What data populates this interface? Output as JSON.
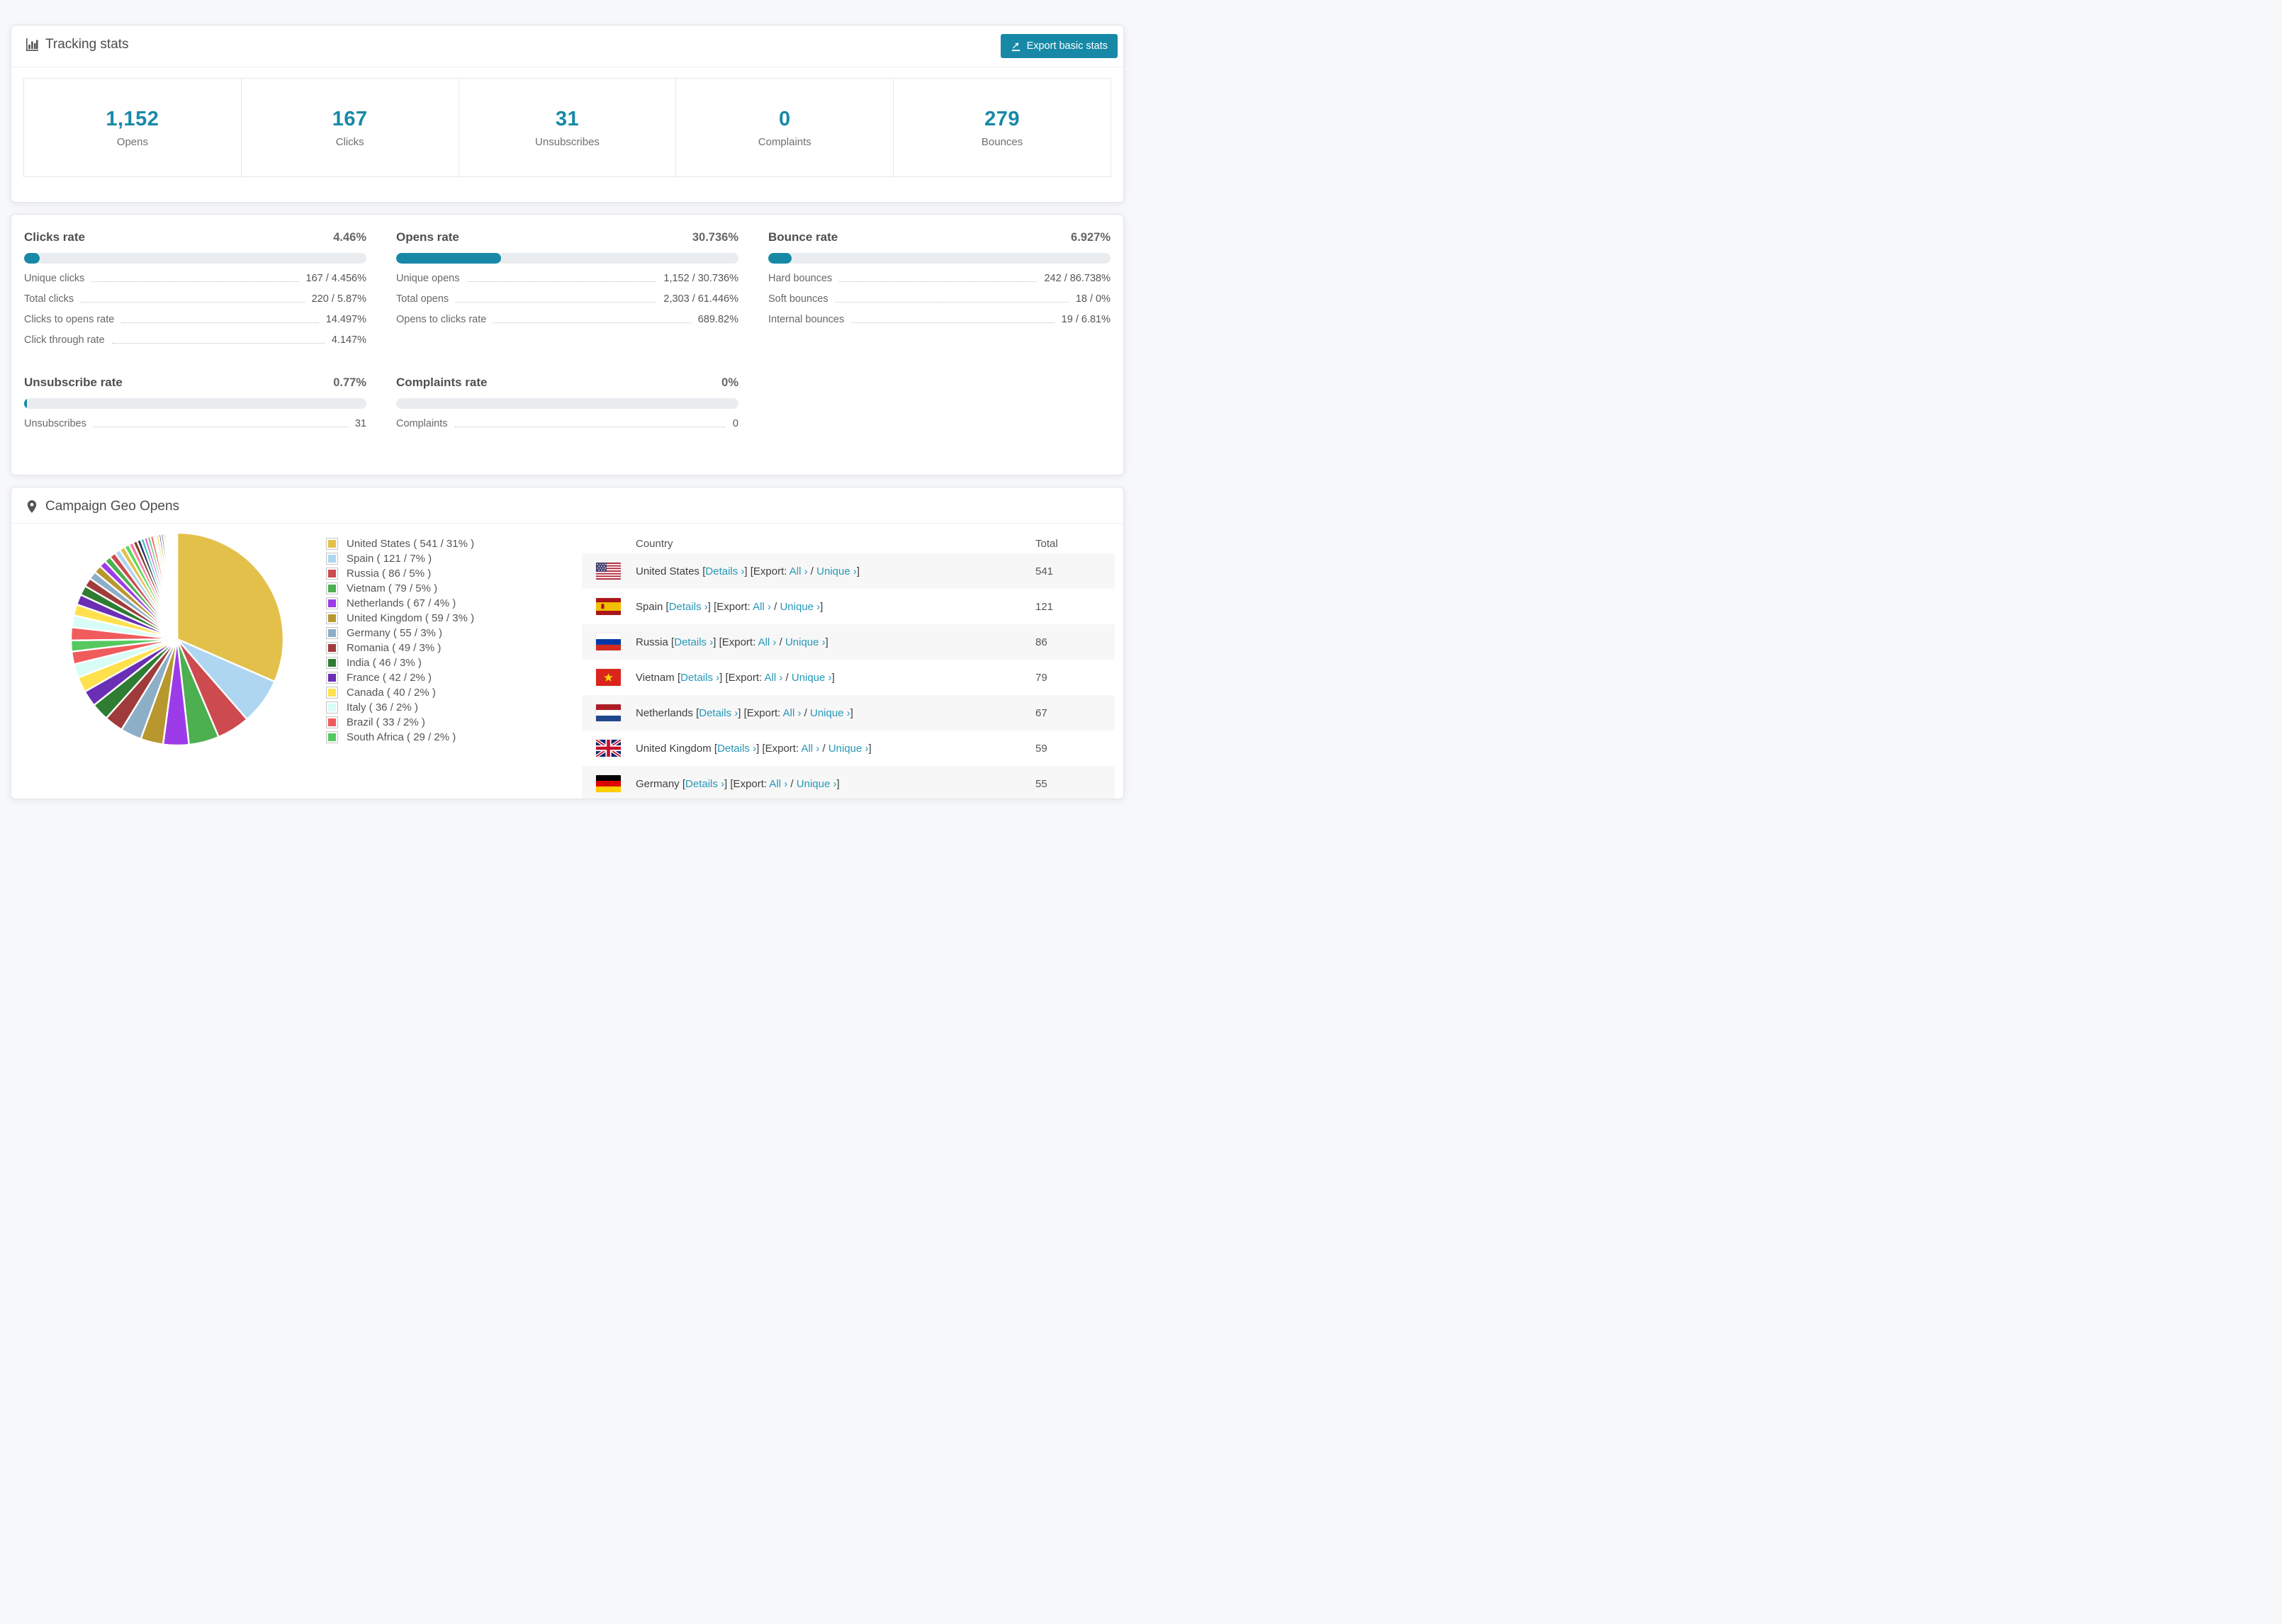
{
  "theme": {
    "accent": "#1789A7",
    "link": "#2798B7",
    "progress_track": "#EAEDF0",
    "table_stripe": "#F7F7F8"
  },
  "tracking_stats": {
    "title": "Tracking stats",
    "title_icon": "bar-chart-icon",
    "export_label": "Export basic stats",
    "export_icon": "export-icon",
    "summary": [
      {
        "value": "1,152",
        "label": "Opens"
      },
      {
        "value": "167",
        "label": "Clicks"
      },
      {
        "value": "31",
        "label": "Unsubscribes"
      },
      {
        "value": "0",
        "label": "Complaints"
      },
      {
        "value": "279",
        "label": "Bounces"
      }
    ]
  },
  "rates": {
    "sections": [
      {
        "id": "clicks-rate",
        "title": "Clicks rate",
        "value": "4.46%",
        "percent": 4.46,
        "rows": [
          [
            "Unique clicks",
            "167 / 4.456%"
          ],
          [
            "Total clicks",
            "220 / 5.87%"
          ],
          [
            "Clicks to opens rate",
            "14.497%"
          ],
          [
            "Click through rate",
            "4.147%"
          ]
        ]
      },
      {
        "id": "opens-rate",
        "title": "Opens rate",
        "value": "30.736%",
        "percent": 30.736,
        "rows": [
          [
            "Unique opens",
            "1,152 / 30.736%"
          ],
          [
            "Total opens",
            "2,303 / 61.446%"
          ],
          [
            "Opens to clicks rate",
            "689.82%"
          ]
        ]
      },
      {
        "id": "bounce-rate",
        "title": "Bounce rate",
        "value": "6.927%",
        "percent": 6.927,
        "rows": [
          [
            "Hard bounces",
            "242 / 86.738%"
          ],
          [
            "Soft bounces",
            "18 / 0%"
          ],
          [
            "Internal bounces",
            "19 / 6.81%"
          ]
        ]
      },
      {
        "id": "unsubscribe-rate",
        "title": "Unsubscribe rate",
        "value": "0.77%",
        "percent": 0.77,
        "rows": [
          [
            "Unsubscribes",
            "31"
          ]
        ]
      },
      {
        "id": "complaints-rate",
        "title": "Complaints rate",
        "value": "0%",
        "percent": 0,
        "rows": [
          [
            "Complaints",
            "0"
          ]
        ]
      }
    ]
  },
  "geo": {
    "title": "Campaign Geo Opens",
    "title_icon": "map-pin-icon",
    "table": {
      "headers": [
        "Country",
        "Total"
      ],
      "details_label": "Details ›",
      "export_prefix": "[Export:",
      "all_label": "All ›",
      "separator": "/",
      "unique_label": "Unique ›",
      "rows": [
        {
          "country": "United States",
          "flag": "us",
          "total": "541"
        },
        {
          "country": "Spain",
          "flag": "es",
          "total": "121"
        },
        {
          "country": "Russia",
          "flag": "ru",
          "total": "86"
        },
        {
          "country": "Vietnam",
          "flag": "vn",
          "total": "79"
        },
        {
          "country": "Netherlands",
          "flag": "nl",
          "total": "67"
        },
        {
          "country": "United Kingdom",
          "flag": "gb",
          "total": "59"
        },
        {
          "country": "Germany",
          "flag": "de",
          "total": "55"
        }
      ]
    }
  },
  "chart_data": {
    "type": "pie",
    "title": "Campaign Geo Opens",
    "legend_position": "right",
    "legend_format": "Label ( value / percent )",
    "start_angle_deg": -90,
    "direction": "clockwise",
    "labels": [
      "United States",
      "Spain",
      "Russia",
      "Vietnam",
      "Netherlands",
      "United Kingdom",
      "Germany",
      "Romania",
      "India",
      "France",
      "Canada",
      "Italy",
      "Brazil",
      "South Africa"
    ],
    "values": [
      541,
      121,
      86,
      79,
      67,
      59,
      55,
      49,
      46,
      42,
      40,
      36,
      33,
      29
    ],
    "percent_labels": [
      "31%",
      "7%",
      "5%",
      "5%",
      "4%",
      "3%",
      "3%",
      "3%",
      "3%",
      "2%",
      "2%",
      "2%",
      "2%",
      "2%"
    ],
    "colors": [
      "#E3C04A",
      "#AED6F1",
      "#CD4A4E",
      "#4CAF50",
      "#9C3BE8",
      "#B9972F",
      "#8CAFC7",
      "#A03B3B",
      "#2E7D32",
      "#6A2FB5",
      "#FFE14D",
      "#D8FDF6",
      "#F05B5C",
      "#55C95F"
    ],
    "extra_colors": [
      "#E06ADC",
      "#35C9A6",
      "#2D2C6E",
      "#7A4A1F",
      "#FF7BAC",
      "#58DB58"
    ],
    "others_note": "many small unlabeled countries, values estimated from slice widths",
    "others_values": [
      34,
      31,
      29,
      27,
      25,
      23,
      21,
      20,
      18,
      17,
      16,
      15,
      14,
      13,
      12,
      11,
      10,
      9,
      9,
      8,
      8,
      7,
      7,
      6,
      6,
      5,
      5,
      4,
      4,
      3,
      3,
      2,
      2,
      2,
      1,
      1,
      1,
      1,
      1,
      1
    ]
  }
}
